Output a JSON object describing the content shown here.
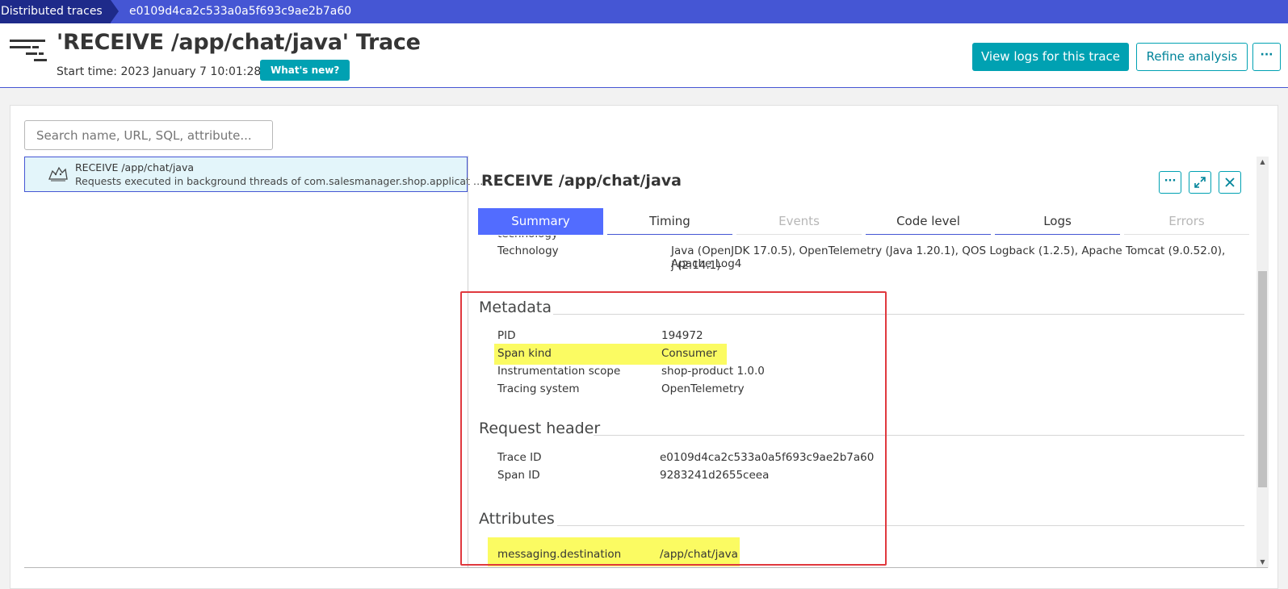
{
  "breadcrumb": {
    "root": "Distributed traces",
    "current": "e0109d4ca2c533a0a5f693c9ae2b7a60"
  },
  "header": {
    "title": "'RECEIVE /app/chat/java' Trace",
    "start_time": "Start time: 2023 January 7 10:01:28",
    "whats_new": "What's new?",
    "view_logs": "View logs for this trace",
    "refine": "Refine analysis",
    "more": "···"
  },
  "search": {
    "placeholder": "Search name, URL, SQL, attribute..."
  },
  "tree": {
    "name": "RECEIVE /app/chat/java",
    "description": "Requests executed in background threads of com.salesmanager.shop.applicat …"
  },
  "detail": {
    "title": "RECEIVE /app/chat/java",
    "tabs": [
      {
        "label": "Summary"
      },
      {
        "label": "Timing"
      },
      {
        "label": "Events"
      },
      {
        "label": "Code level"
      },
      {
        "label": "Logs"
      },
      {
        "label": "Errors"
      }
    ],
    "cutoff_label": "technology",
    "technology": {
      "key": "Technology",
      "value_line1": "Java (OpenJDK 17.0.5), OpenTelemetry (Java 1.20.1), QOS Logback (1.2.5), Apache Tomcat (9.0.52.0), Apache Log4",
      "value_line2": "j (2.14.1)"
    },
    "metadata": {
      "title": "Metadata",
      "rows": [
        {
          "key": "PID",
          "value": "194972"
        },
        {
          "key": "Span kind",
          "value": "Consumer"
        },
        {
          "key": "Instrumentation scope",
          "value": "shop-product 1.0.0"
        },
        {
          "key": "Tracing system",
          "value": "OpenTelemetry"
        }
      ]
    },
    "request_header": {
      "title": "Request header",
      "rows": [
        {
          "key": "Trace ID",
          "value": "e0109d4ca2c533a0a5f693c9ae2b7a60"
        },
        {
          "key": "Span ID",
          "value": "9283241d2655ceea"
        }
      ]
    },
    "attributes": {
      "title": "Attributes",
      "rows": [
        {
          "key": "messaging.destination",
          "value": "/app/chat/java"
        }
      ]
    }
  },
  "colors": {
    "brand_blue": "#4556d4",
    "teal": "#00a1b2",
    "highlight": "#fbfb62",
    "annotation_red": "#e0393e"
  }
}
